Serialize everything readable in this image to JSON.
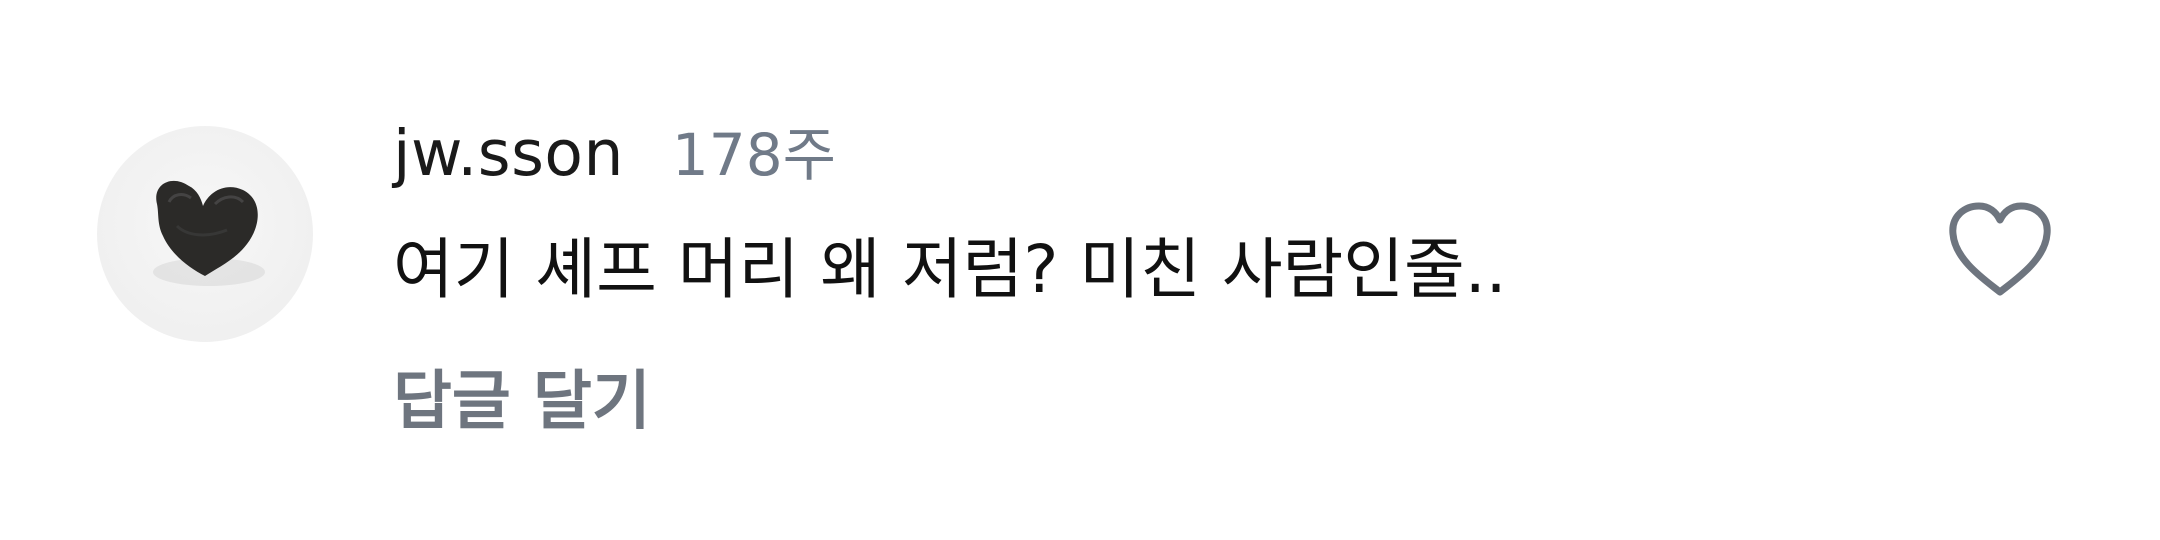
{
  "comment": {
    "username": "jw.sson",
    "timestamp": "178주",
    "text": "여기 셰프 머리 왜 저럼? 미친 사람인줄..",
    "reply_label": "답글 달기",
    "avatar_icon": "heart-shaped-object-avatar",
    "like_icon": "heart-outline-icon"
  },
  "colors": {
    "username": "#1a1a1a",
    "timestamp": "#707a88",
    "reply": "#6e757f",
    "like_icon": "#6e757f"
  }
}
